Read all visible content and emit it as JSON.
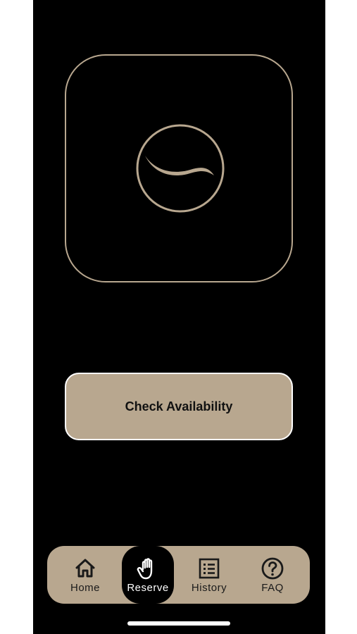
{
  "main": {
    "action_button_label": "Check Availability"
  },
  "tab_bar": {
    "tabs": [
      {
        "label": "Home",
        "icon": "home-icon",
        "active": false
      },
      {
        "label": "Reserve",
        "icon": "hand-icon",
        "active": true
      },
      {
        "label": "History",
        "icon": "list-icon",
        "active": false
      },
      {
        "label": "FAQ",
        "icon": "question-circle-icon",
        "active": false
      }
    ]
  },
  "colors": {
    "background": "#000000",
    "accent": "#b8a78f",
    "button_border": "#ffffff",
    "text_dark": "#111111"
  }
}
